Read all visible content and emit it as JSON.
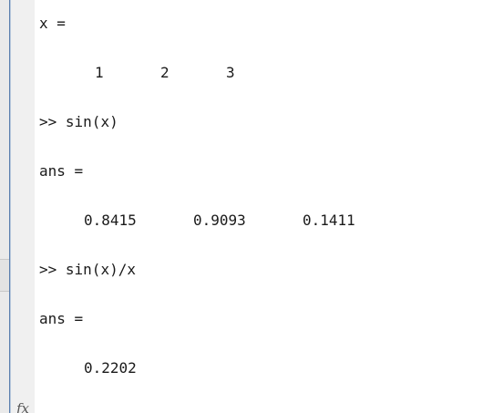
{
  "console": {
    "x_header": "x =",
    "x_values": [
      "1",
      "2",
      "3"
    ],
    "cmd1": {
      "prompt": ">>",
      "text": "sin(x)"
    },
    "ans1_header": "ans =",
    "ans1_values": [
      "0.8415",
      "0.9093",
      "0.1411"
    ],
    "cmd2": {
      "prompt": ">>",
      "text": "sin(x)/x"
    },
    "ans2_header": "ans =",
    "ans2_values": [
      "0.2202"
    ]
  },
  "fx_label": "fx"
}
